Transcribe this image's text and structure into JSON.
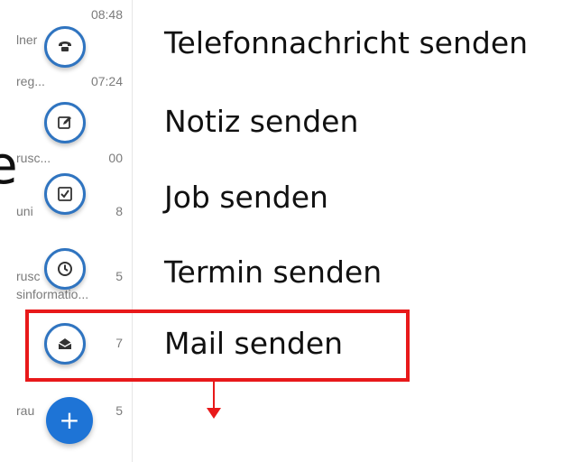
{
  "list": {
    "items": [
      {
        "left": "lner",
        "right": "08:48"
      },
      {
        "left": "reg...",
        "right": "07:24"
      },
      {
        "left": "rusc...",
        "right": "00"
      },
      {
        "left": "uni",
        "right": "8"
      },
      {
        "left": "rusc",
        "right": "5",
        "extra": "sinformatio..."
      },
      {
        "left": "",
        "right": "7"
      },
      {
        "left": "rau",
        "right": "5"
      }
    ]
  },
  "page_fragment": "e",
  "fab": {
    "icons": [
      "phone-icon",
      "edit-icon",
      "checkbox-icon",
      "clock-icon",
      "mail-icon",
      "plus-icon"
    ],
    "main_label": "+"
  },
  "menu": {
    "items": [
      "Telefonnachricht senden",
      "Notiz senden",
      "Job senden",
      "Termin senden",
      "Mail senden"
    ]
  },
  "annotation": {
    "color": "#e8191a"
  },
  "colors": {
    "accent": "#1e74d6",
    "ring": "#2f74c0"
  }
}
